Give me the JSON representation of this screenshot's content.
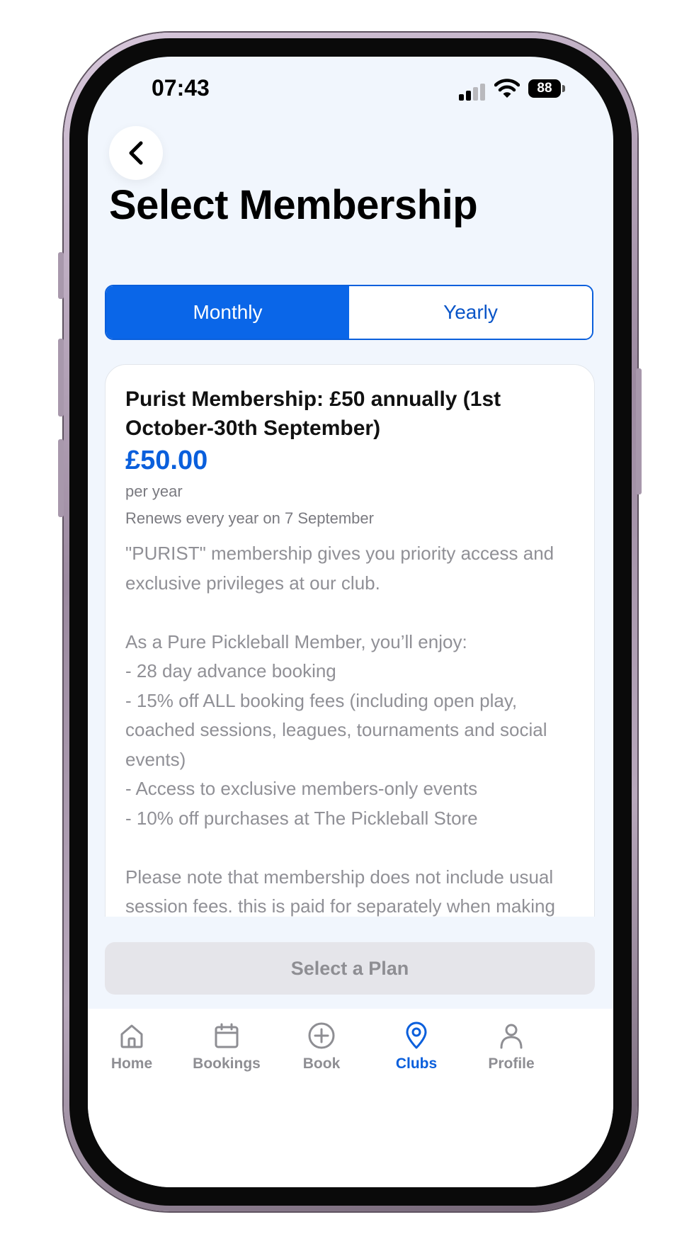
{
  "status_bar": {
    "time": "07:43",
    "battery": "88"
  },
  "header": {
    "title": "Select Membership"
  },
  "billing_toggle": {
    "options": [
      {
        "label": "Monthly",
        "selected": true
      },
      {
        "label": "Yearly",
        "selected": false
      }
    ]
  },
  "plan": {
    "name": "Purist Membership: £50 annually (1st October-30th September)",
    "price": "£50.00",
    "period": "per year",
    "renewal": "Renews every year on 7 September",
    "description": "\"PURIST\" membership gives you priority access and exclusive privileges at our club.\n\nAs a Pure Pickleball Member, you’ll enjoy:\n- 28 day advance booking\n- 15% off ALL booking fees (including open play, coached sessions, leagues, tournaments and social events)\n- Access to exclusive members-only events\n- 10% off purchases at The Pickleball Store\n\nPlease note that membership does not include usual session fees. this is paid for separately when making your booking through PicklePro and your members discount will be applied"
  },
  "cta": {
    "label": "Select a Plan"
  },
  "tab_bar": {
    "items": [
      {
        "label": "Home",
        "icon": "home-icon"
      },
      {
        "label": "Bookings",
        "icon": "calendar-icon"
      },
      {
        "label": "Book",
        "icon": "plus-circle-icon"
      },
      {
        "label": "Clubs",
        "icon": "location-pin-icon",
        "active": true
      },
      {
        "label": "Profile",
        "icon": "person-icon"
      }
    ]
  },
  "colors": {
    "accent": "#0a66e8",
    "inactive": "#8e8e93",
    "background": "#f1f6fd"
  }
}
